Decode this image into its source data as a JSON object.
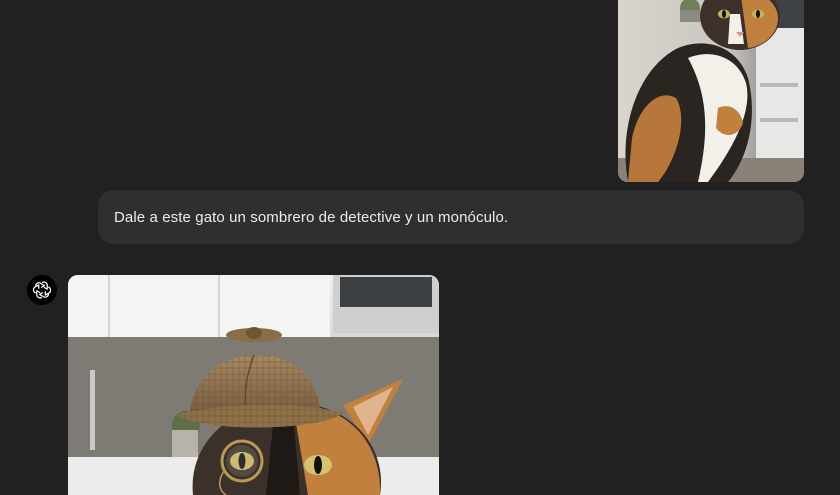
{
  "conversation": {
    "user_message": {
      "text": "Dale a este gato un sombrero de detective y un monóculo."
    },
    "user_attachment": {
      "subject": "calico-cat-photo"
    },
    "assistant_message": {
      "avatar_icon": "openai-logo-icon",
      "generated_image_subject": "calico-cat-detective-hat-monocle"
    }
  },
  "theme": {
    "background": "#212121",
    "bubble": "#2f2f2f",
    "text": "#ececec",
    "avatar_bg": "#000000"
  }
}
